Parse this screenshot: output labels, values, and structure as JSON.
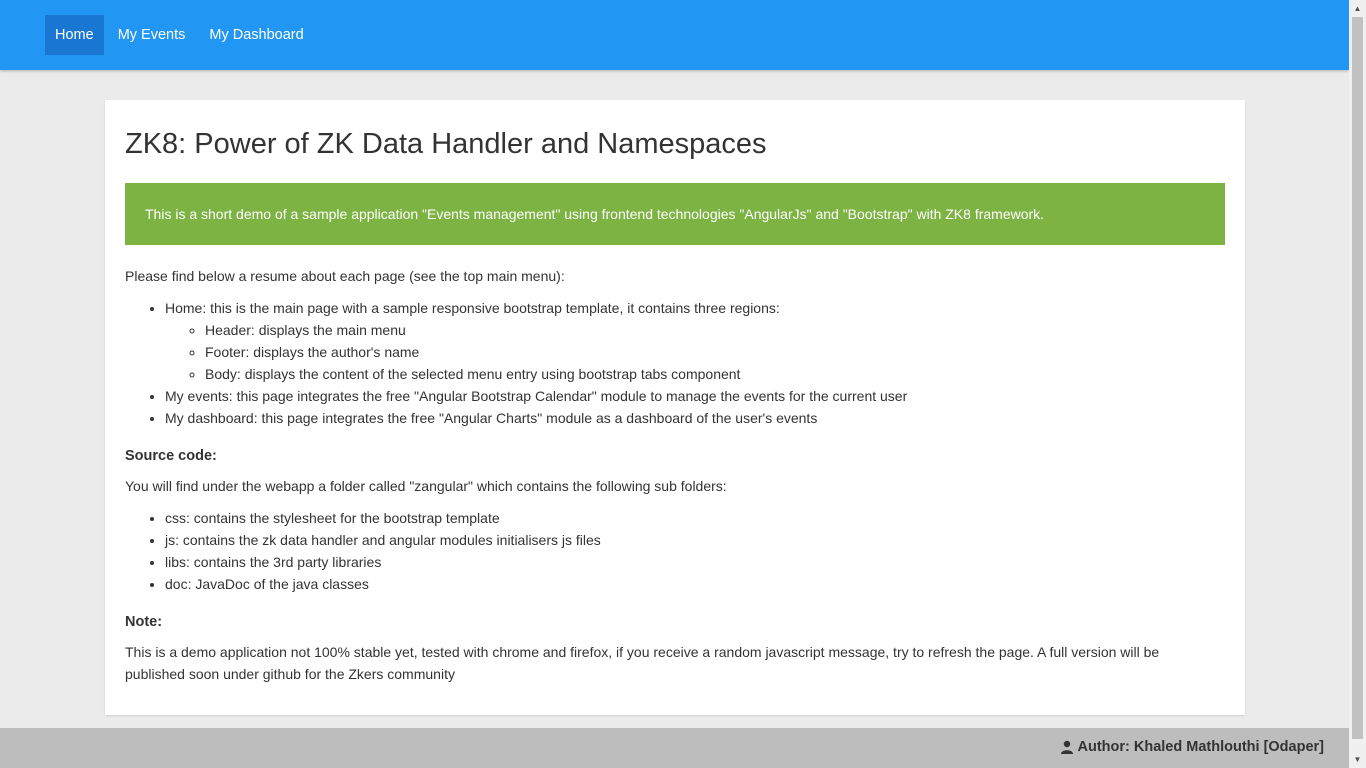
{
  "nav": {
    "items": [
      "Home",
      "My Events",
      "My Dashboard"
    ]
  },
  "main": {
    "title": "ZK8: Power of ZK Data Handler and Namespaces",
    "alert": "This is a short demo of a sample application \"Events management\" using frontend technologies \"AngularJs\" and \"Bootstrap\" with ZK8 framework.",
    "intro": "Please find below a resume about each page (see the top main menu):",
    "pages": {
      "home": "Home: this is the main page with a sample responsive bootstrap template, it contains three regions:",
      "regions": [
        "Header: displays the main menu",
        "Footer: displays the author's name",
        "Body: displays the content of the selected menu entry using bootstrap tabs component"
      ],
      "events": "My events: this page integrates the free \"Angular Bootstrap Calendar\" module to manage the events for the current user",
      "dashboard": "My dashboard: this page integrates the free \"Angular Charts\" module as a dashboard of the user's events"
    },
    "source_heading": "Source code:",
    "source_intro": "You will find under the webapp a folder called \"zangular\" which contains the following sub folders:",
    "folders": [
      "css: contains the stylesheet for the bootstrap template",
      "js: contains the zk data handler and angular modules initialisers js files",
      "libs: contains the 3rd party libraries",
      "doc: JavaDoc of the java classes"
    ],
    "note_heading": "Note:",
    "note": "This is a demo application not 100% stable yet, tested with chrome and firefox, if you receive a random javascript message, try to refresh the page. A full version will be published soon under github for the Zkers community"
  },
  "footer": {
    "author": "Author: Khaled Mathlouthi [Odaper]",
    "icon": "user-icon"
  },
  "colors": {
    "navbar": "#2196f3",
    "nav_active": "#1976d2",
    "alert": "#7cb342",
    "footer": "#bdbdbd"
  }
}
